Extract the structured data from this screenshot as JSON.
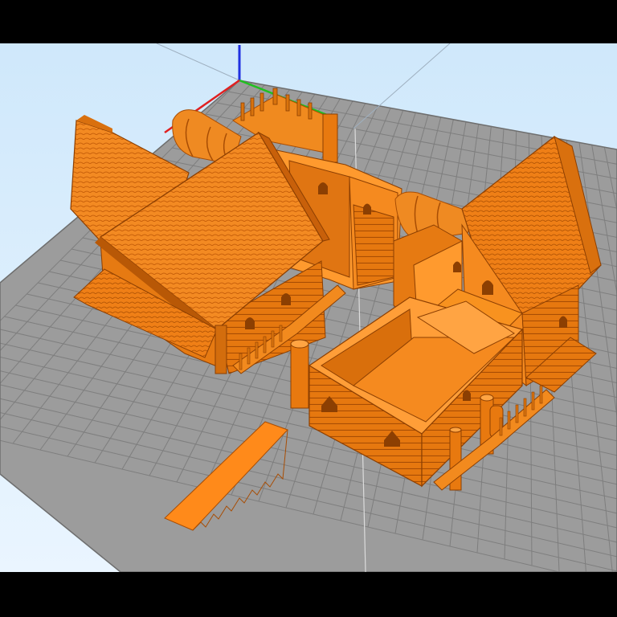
{
  "app": {
    "view": "3d-slicer-build-plate",
    "description_hidden": ""
  },
  "colors": {
    "sky_top": "#cfe8fb",
    "sky_bottom": "#eaf5ff",
    "plate": "#9a9a9a",
    "plate_line": "#7d7d7d",
    "model_light": "#ff9a2e",
    "model_mid": "#f0821a",
    "model_dark": "#c8600a",
    "model_deep": "#8c3f02",
    "axis_x": "#e02020",
    "axis_y": "#20c020",
    "axis_z": "#2030e0"
  },
  "axes": {
    "x_icon": "axis-x",
    "y_icon": "axis-y",
    "z_icon": "axis-z"
  },
  "objects": [
    {
      "name": "left-house",
      "icon": "house-roof"
    },
    {
      "name": "right-house",
      "icon": "house-roof"
    },
    {
      "name": "center-walls",
      "icon": "wall-module"
    },
    {
      "name": "front-box",
      "icon": "open-box-module"
    },
    {
      "name": "loose-roof-strip",
      "icon": "roof-strip"
    },
    {
      "name": "back-barrel",
      "icon": "barrel"
    }
  ]
}
